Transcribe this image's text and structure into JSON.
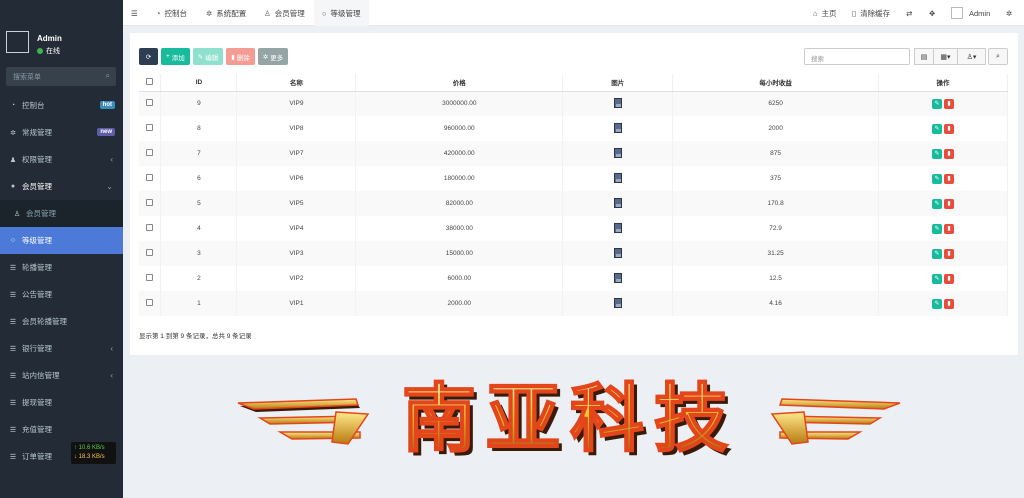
{
  "sidebar": {
    "username": "Admin",
    "status": "在线",
    "search_placeholder": "搜索菜单",
    "items": [
      {
        "label": "控制台",
        "icon": "dashboard-icon",
        "badge": "hot",
        "badge_color": "#3c8dbc"
      },
      {
        "label": "常规管理",
        "icon": "cogs-icon",
        "badge": "new",
        "badge_color": "#605ca8"
      },
      {
        "label": "权限管理",
        "icon": "group-icon",
        "chevron": "‹"
      },
      {
        "label": "会员管理",
        "icon": "user-circle-icon",
        "chevron": "⌄"
      },
      {
        "label": "会员管理",
        "icon": "user-icon"
      },
      {
        "label": "等级管理",
        "icon": "circle-o-icon"
      },
      {
        "label": "轮播管理",
        "icon": "list-icon"
      },
      {
        "label": "公告管理",
        "icon": "list-icon"
      },
      {
        "label": "会员轮播管理",
        "icon": "list-icon"
      },
      {
        "label": "银行管理",
        "icon": "list-icon",
        "chevron": "‹"
      },
      {
        "label": "站内信管理",
        "icon": "list-icon",
        "chevron": "‹"
      },
      {
        "label": "提现管理",
        "icon": "list-icon"
      },
      {
        "label": "充值管理",
        "icon": "list-icon"
      },
      {
        "label": "订单管理",
        "icon": "list-icon"
      }
    ],
    "netspeed": {
      "up": "↑ 10.6 KB/s",
      "down": "↓ 18.3 KB/s"
    }
  },
  "topbar": {
    "tabs": [
      {
        "label": "控制台",
        "icon": "dashboard-icon"
      },
      {
        "label": "系统配置",
        "icon": "gear-icon"
      },
      {
        "label": "会员管理",
        "icon": "user-icon"
      },
      {
        "label": "等级管理",
        "icon": "circle-o-icon"
      }
    ],
    "home": "主页",
    "clear_cache": "清除缓存",
    "admin": "Admin"
  },
  "toolbar": {
    "add": "添加",
    "edit": "编辑",
    "delete": "删除",
    "more": "更多",
    "search_placeholder": "搜索"
  },
  "table": {
    "headers": [
      "ID",
      "名称",
      "价格",
      "图片",
      "每小时收益",
      "操作"
    ],
    "rows": [
      {
        "id": "9",
        "name": "VIP9",
        "price": "3000000.00",
        "income": "6250"
      },
      {
        "id": "8",
        "name": "VIP8",
        "price": "960000.00",
        "income": "2000"
      },
      {
        "id": "7",
        "name": "VIP7",
        "price": "420000.00",
        "income": "875"
      },
      {
        "id": "6",
        "name": "VIP6",
        "price": "180000.00",
        "income": "375"
      },
      {
        "id": "5",
        "name": "VIP5",
        "price": "82000.00",
        "income": "170.8"
      },
      {
        "id": "4",
        "name": "VIP4",
        "price": "38000.00",
        "income": "72.9"
      },
      {
        "id": "3",
        "name": "VIP3",
        "price": "15000.00",
        "income": "31.25"
      },
      {
        "id": "2",
        "name": "VIP2",
        "price": "6000.00",
        "income": "12.5"
      },
      {
        "id": "1",
        "name": "VIP1",
        "price": "2000.00",
        "income": "4.16"
      }
    ]
  },
  "pagination": "显示第 1 到第 9 条记录，总共 9 条记录",
  "banner": {
    "text": "南亚科技"
  }
}
